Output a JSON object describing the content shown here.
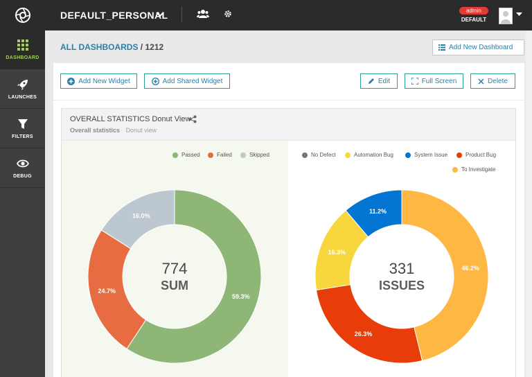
{
  "sidebar": {
    "items": [
      {
        "label": "DASHBOARD",
        "icon": "grid-icon"
      },
      {
        "label": "LAUNCHES",
        "icon": "rocket-icon"
      },
      {
        "label": "FILTERS",
        "icon": "filter-icon"
      },
      {
        "label": "DEBUG",
        "icon": "eye-icon"
      }
    ]
  },
  "header": {
    "project": "DEFAULT_PERSONAL",
    "role_badge": "admin",
    "user": "DEFAULT"
  },
  "breadcrumb": {
    "root": "ALL DASHBOARDS",
    "separator": "/",
    "current": "1212"
  },
  "toolbar": {
    "add_dashboard": "Add New Dashboard",
    "add_widget": "Add New Widget",
    "add_shared_widget": "Add Shared Widget",
    "edit": "Edit",
    "full_screen": "Full Screen",
    "delete": "Delete"
  },
  "widget": {
    "title": "OVERALL STATISTICS Donut View",
    "subtitle_name": "Overall statistics",
    "subtitle_view": "Donut view"
  },
  "colors": {
    "accent": "#2a7fa6",
    "passed": "#8db677",
    "failed": "#e86c42",
    "skipped": "#bdc7cf",
    "no_defect": "#777777",
    "automation_bug": "#f7d63e",
    "system_issue": "#0274d1",
    "product_bug": "#e83c0b",
    "to_investigate": "#ffb743"
  },
  "chart_data": [
    {
      "type": "pie",
      "categories": [
        "Passed",
        "Failed",
        "Skipped"
      ],
      "values": [
        59.3,
        24.7,
        16.0
      ],
      "value_labels": [
        "59.3%",
        "24.7%",
        "16.0%"
      ],
      "center_value": "774",
      "center_label": "SUM",
      "legend": "top-right"
    },
    {
      "type": "pie",
      "categories": [
        "No Defect",
        "Automation Bug",
        "System Issue",
        "Product Bug",
        "To Investigate"
      ],
      "values": [
        0,
        16.3,
        11.2,
        26.3,
        46.2
      ],
      "value_labels": [
        "",
        "16.3%",
        "11.2%",
        "26.3%",
        "46.2%"
      ],
      "center_value": "331",
      "center_label": "ISSUES",
      "legend": "top"
    }
  ]
}
